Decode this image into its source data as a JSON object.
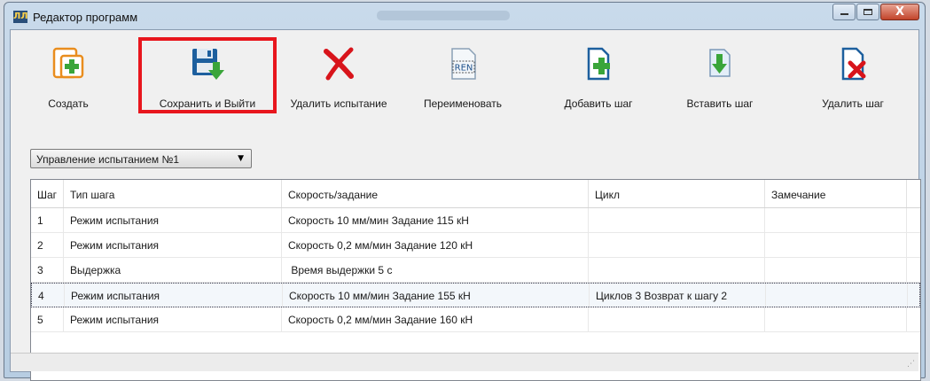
{
  "window": {
    "title": "Редактор программ",
    "app_icon": "ЛЛ",
    "close_glyph": "X"
  },
  "toolbar": {
    "create": "Создать",
    "save_exit": "Сохранить и Выйти",
    "delete_test": "Удалить испытание",
    "rename": "Переименовать",
    "rename_icon_text": "REN",
    "add_step": "Добавить шаг",
    "insert_step": "Вставить шаг",
    "delete_step": "Удалить шаг"
  },
  "combo": {
    "value": "Управление испытанием №1",
    "arrow": "▼"
  },
  "table": {
    "columns": [
      "Шаг",
      "Тип шага",
      "Скорость/задание",
      "Цикл",
      "Замечание"
    ],
    "rows": [
      [
        "1",
        "Режим испытания",
        "Скорость 10 мм/мин Задание 115 кН",
        "",
        ""
      ],
      [
        "2",
        "Режим испытания",
        "Скорость 0,2 мм/мин Задание 120 кН",
        "",
        ""
      ],
      [
        "3",
        "Выдержка",
        " Время выдержки 5 с",
        "",
        ""
      ],
      [
        "4",
        "Режим испытания",
        "Скорость 10 мм/мин Задание 155 кН",
        "Циклов 3 Возврат к шагу 2",
        ""
      ],
      [
        "5",
        "Режим испытания",
        "Скорость 0,2 мм/мин Задание 160 кН",
        "",
        ""
      ]
    ],
    "selected_row": 4
  },
  "colors": {
    "highlight": "#e8161d",
    "accent_green": "#3aa53a",
    "accent_red": "#d8141b",
    "icon_blue": "#1d5f9e"
  },
  "icons": [
    "app-icon",
    "create-icon",
    "save-icon",
    "delete-icon",
    "rename-icon",
    "add-step-icon",
    "insert-step-icon",
    "delete-step-icon"
  ]
}
